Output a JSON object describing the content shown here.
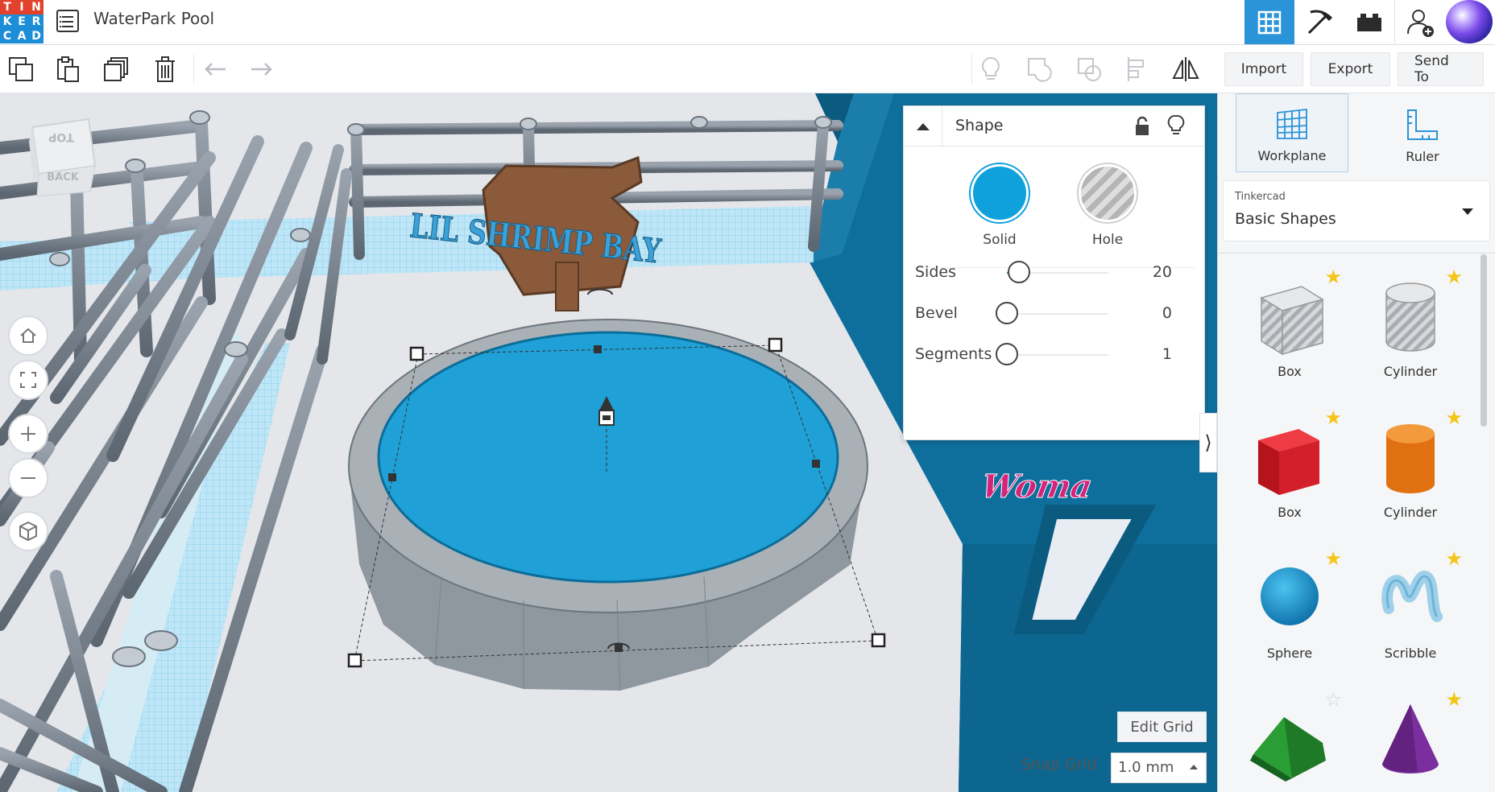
{
  "app": {
    "logo_letters": [
      "T",
      "I",
      "N",
      "K",
      "E",
      "R",
      "C",
      "A",
      "D"
    ],
    "logo_colors": [
      "#e2412b",
      "#e2412b",
      "#e2412b",
      "#1d8dd8",
      "#1d8dd8",
      "#1d8dd8",
      "#1d8dd8",
      "#1d8dd8",
      "#1d8dd8"
    ],
    "design_title": "WaterPark Pool",
    "accent_color": "#2b93d8"
  },
  "header": {
    "views": [
      {
        "name": "3d-design",
        "icon": "grid-icon",
        "active": true
      },
      {
        "name": "codeblocks",
        "icon": "pickaxe-icon",
        "active": false
      },
      {
        "name": "bricks",
        "icon": "bricks-icon",
        "active": false
      }
    ],
    "add_user_icon": "add-user-icon"
  },
  "toolbar": {
    "left_tools": [
      "copy-icon",
      "paste-icon",
      "duplicate-icon",
      "delete-icon",
      "undo-icon",
      "redo-icon"
    ],
    "right_tools": [
      "notes-icon",
      "group-icon",
      "ungroup-icon",
      "align-icon",
      "mirror-icon"
    ],
    "import_label": "Import",
    "export_label": "Export",
    "sendto_label": "Send To"
  },
  "viewcube": {
    "top": "TOP",
    "back": "BACK"
  },
  "scene": {
    "sign_text": "LIL SHRIMP BAY",
    "wall_text": "Woma"
  },
  "shape_panel": {
    "title": "Shape",
    "solid_label": "Solid",
    "hole_label": "Hole",
    "solid_color": "#0ea1db",
    "params": [
      {
        "label": "Sides",
        "value": "20",
        "fraction": 0.12
      },
      {
        "label": "Bevel",
        "value": "0",
        "fraction": 0.0
      },
      {
        "label": "Segments",
        "value": "1",
        "fraction": 0.0
      }
    ]
  },
  "grid": {
    "edit_grid_label": "Edit Grid",
    "snap_grid_label": "Snap Grid",
    "snap_grid_value": "1.0 mm"
  },
  "sidebar": {
    "workplane_label": "Workplane",
    "ruler_label": "Ruler",
    "library_sub": "Tinkercad",
    "library_name": "Basic Shapes",
    "shapes": [
      {
        "name": "Box",
        "kind": "box-hole",
        "starred": true
      },
      {
        "name": "Cylinder",
        "kind": "cylinder-hole",
        "starred": true
      },
      {
        "name": "Box",
        "kind": "box",
        "starred": true
      },
      {
        "name": "Cylinder",
        "kind": "cylinder",
        "starred": true
      },
      {
        "name": "Sphere",
        "kind": "sphere",
        "starred": true
      },
      {
        "name": "Scribble",
        "kind": "scribble",
        "starred": true
      },
      {
        "name": "",
        "kind": "roof",
        "starred": false
      },
      {
        "name": "",
        "kind": "cone",
        "starred": true
      }
    ]
  }
}
